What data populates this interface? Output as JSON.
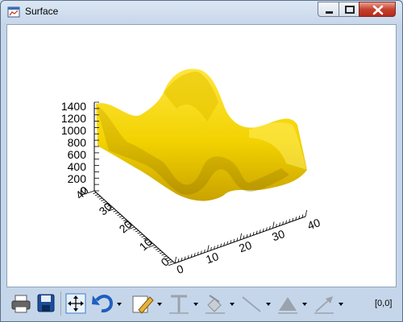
{
  "window": {
    "title": "Surface"
  },
  "titlebar": {
    "controls": [
      "minimize-icon",
      "maximize-icon",
      "close-icon"
    ]
  },
  "plot": {
    "z_ticks": [
      "1400",
      "1200",
      "1000",
      "800",
      "600",
      "400",
      "200",
      "0"
    ],
    "y_ticks": [
      "0",
      "10",
      "20",
      "30",
      "40"
    ],
    "x_ticks": [
      "0",
      "10",
      "20",
      "30",
      "40"
    ],
    "surface_color": "#f2d200"
  },
  "chart_data": {
    "type": "surface",
    "title": "",
    "x_range": [
      0,
      40
    ],
    "y_range": [
      0,
      40
    ],
    "z_range": [
      0,
      1400
    ],
    "grid": false
  },
  "toolbar": {
    "items": [
      "print-icon",
      "save-icon",
      "pan-icon",
      "undo-icon",
      "pencil-icon",
      "text-icon",
      "fill-icon",
      "line-icon",
      "shape-icon",
      "arrow-icon"
    ]
  },
  "status": {
    "coords": "[0,0]"
  }
}
